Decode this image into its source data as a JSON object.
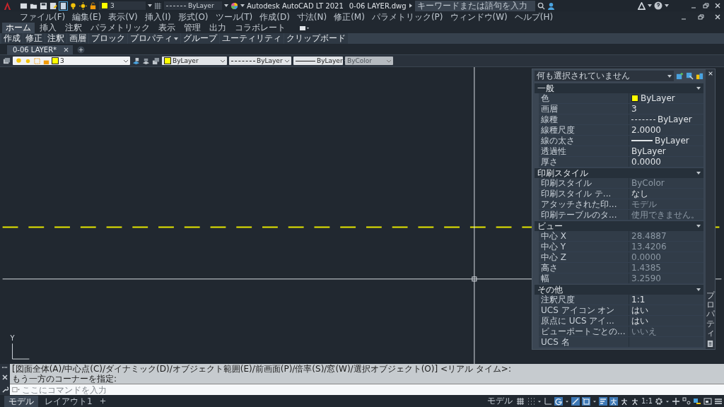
{
  "title_bar": {
    "title": "Autodesk AutoCAD LT 2021",
    "file": "0-06 LAYER.dwg",
    "layer": {
      "name": "3",
      "color": "#ffff00"
    },
    "linetype": "ByLayer",
    "search_placeholder": "キーワードまたは語句を入力"
  },
  "menu": [
    "ファイル(F)",
    "編集(E)",
    "表示(V)",
    "挿入(I)",
    "形式(O)",
    "ツール(T)",
    "作成(D)",
    "寸法(N)",
    "修正(M)",
    "パラメトリック(P)",
    "ウィンドウ(W)",
    "ヘルプ(H)"
  ],
  "ribbon_tabs": [
    {
      "label": "ホーム",
      "selected": true
    },
    {
      "label": "挿入",
      "selected": false
    },
    {
      "label": "注釈",
      "selected": false
    },
    {
      "label": "パラメトリック",
      "selected": false
    },
    {
      "label": "表示",
      "selected": false
    },
    {
      "label": "管理",
      "selected": false
    },
    {
      "label": "出力",
      "selected": false
    },
    {
      "label": "コラボレート",
      "selected": false
    }
  ],
  "ribbon_panels": [
    {
      "label": "作成",
      "menu": false
    },
    {
      "label": "修正",
      "menu": false
    },
    {
      "label": "注釈",
      "menu": false
    },
    {
      "label": "画層",
      "menu": false
    },
    {
      "label": "ブロック",
      "menu": false
    },
    {
      "label": "プロパティ",
      "menu": true
    },
    {
      "label": "グループ",
      "menu": false
    },
    {
      "label": "ユーティリティ",
      "menu": false
    },
    {
      "label": "クリップボード",
      "menu": false
    }
  ],
  "doc_tabs": [
    {
      "label": "0-06 LAYER*",
      "selected": true
    }
  ],
  "properties_toolbar": {
    "layer": {
      "name": "3",
      "color": "#ffff00"
    },
    "color": {
      "label": "ByLayer",
      "color": "#ffff00"
    },
    "linetype": "ByLayer",
    "lineweight": "ByLayer",
    "plot_style": {
      "label": "ByColor",
      "disabled": true
    }
  },
  "ucs_label": "Y",
  "properties_palette": {
    "title": "プロパティ",
    "selection": "何も選択されていません",
    "sections": [
      {
        "title": "一般",
        "expanded": true,
        "rows": [
          {
            "label": "色",
            "value": "ByLayer",
            "kind": "color",
            "color": "#ffff00",
            "disabled": false
          },
          {
            "label": "画層",
            "value": "3",
            "kind": "text",
            "disabled": false
          },
          {
            "label": "線種",
            "value": "ByLayer",
            "kind": "linetype",
            "disabled": false
          },
          {
            "label": "線種尺度",
            "value": "2.0000",
            "kind": "text",
            "disabled": false
          },
          {
            "label": "線の太さ",
            "value": "ByLayer",
            "kind": "lineweight",
            "disabled": false
          },
          {
            "label": "透過性",
            "value": "ByLayer",
            "kind": "text",
            "disabled": false
          },
          {
            "label": "厚さ",
            "value": "0.0000",
            "kind": "text",
            "disabled": false
          }
        ]
      },
      {
        "title": "印刷スタイル",
        "expanded": true,
        "rows": [
          {
            "label": "印刷スタイル",
            "value": "ByColor",
            "kind": "text",
            "disabled": true
          },
          {
            "label": "印刷スタイル テ...",
            "value": "なし",
            "kind": "text",
            "disabled": false
          },
          {
            "label": "アタッチされた印...",
            "value": "モデル",
            "kind": "text",
            "disabled": true
          },
          {
            "label": "印刷テーブルのタ...",
            "value": "使用できません。",
            "kind": "text",
            "disabled": true
          }
        ]
      },
      {
        "title": "ビュー",
        "expanded": true,
        "rows": [
          {
            "label": "中心 X",
            "value": "28.4887",
            "kind": "text",
            "disabled": true
          },
          {
            "label": "中心 Y",
            "value": "13.4206",
            "kind": "text",
            "disabled": true
          },
          {
            "label": "中心 Z",
            "value": "0.0000",
            "kind": "text",
            "disabled": true
          },
          {
            "label": "高さ",
            "value": "1.4385",
            "kind": "text",
            "disabled": true
          },
          {
            "label": "幅",
            "value": "3.2590",
            "kind": "text",
            "disabled": true
          }
        ]
      },
      {
        "title": "その他",
        "expanded": true,
        "rows": [
          {
            "label": "注釈尺度",
            "value": "1:1",
            "kind": "text",
            "disabled": false
          },
          {
            "label": "UCS アイコン オン",
            "value": "はい",
            "kind": "text",
            "disabled": false
          },
          {
            "label": "原点に UCS アイ...",
            "value": "はい",
            "kind": "text",
            "disabled": false
          },
          {
            "label": "ビューポートごとの...",
            "value": "いいえ",
            "kind": "text",
            "disabled": true
          },
          {
            "label": "UCS 名",
            "kind": "text"
          }
        ]
      }
    ]
  },
  "command": {
    "history": [
      "[図面全体(A)/中心点(C)/ダイナミック(D)/オブジェクト範囲(E)/前画面(P)/倍率(S)/窓(W)/選択オブジェクト(O)] <リアル タイム>:",
      "もう一方のコーナーを指定:"
    ],
    "placeholder": "ここにコマンドを入力"
  },
  "layout_tabs": [
    {
      "label": "モデル",
      "selected": true
    },
    {
      "label": "レイアウト1",
      "selected": false
    }
  ],
  "status_bar": {
    "model_label": "モデル",
    "scale": "1:1",
    "toggles": [
      {
        "kind": "grid",
        "on": false
      },
      {
        "kind": "snap",
        "on": false
      },
      {
        "kind": "caret"
      },
      {
        "kind": "ortho",
        "on": false
      },
      {
        "kind": "polar",
        "on": true
      },
      {
        "kind": "caret"
      },
      {
        "kind": "iso",
        "on": true
      },
      {
        "kind": "osnap",
        "on": true
      },
      {
        "kind": "caret"
      },
      {
        "kind": "lineweight",
        "on": true
      },
      {
        "kind": "annovis",
        "on": true
      },
      {
        "kind": "annoauto",
        "on": false
      },
      {
        "kind": "annoscale",
        "on": false
      }
    ],
    "tools": [
      {
        "kind": "gear"
      },
      {
        "kind": "caret"
      },
      {
        "kind": "plus"
      },
      {
        "kind": "isolate"
      },
      {
        "kind": "hardware"
      },
      {
        "kind": "clean"
      },
      {
        "kind": "menu"
      }
    ]
  }
}
